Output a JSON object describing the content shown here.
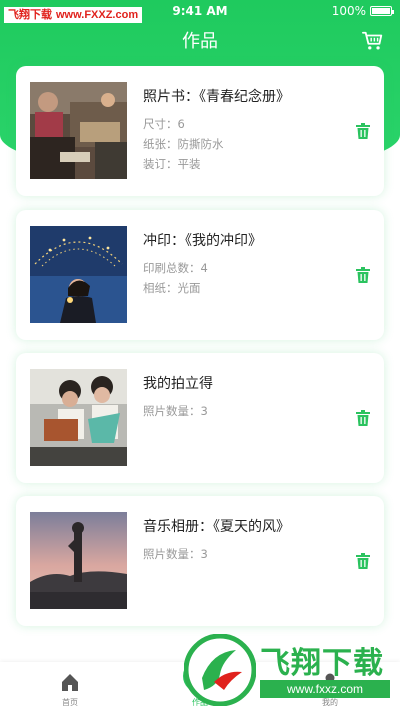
{
  "status_bar": {
    "watermark_label": "飞翔下载",
    "watermark_url": "www.FXXZ.com",
    "time": "9:41 AM",
    "battery": "100%"
  },
  "header": {
    "title": "作品",
    "cart_icon": "cart-icon"
  },
  "works": [
    {
      "title": "照片书：《青春纪念册》",
      "meta": [
        {
          "label": "尺寸：",
          "value": "6"
        },
        {
          "label": "纸张：",
          "value": "防撕防水"
        },
        {
          "label": "装订：",
          "value": "平装"
        }
      ],
      "photo": "street-market-photo"
    },
    {
      "title": "冲印：《我的冲印》",
      "meta": [
        {
          "label": "印刷总数：",
          "value": "4"
        },
        {
          "label": "相纸：",
          "value": "光面"
        }
      ],
      "photo": "girl-umbrella-lights-photo"
    },
    {
      "title": "我的拍立得",
      "meta": [
        {
          "label": "照片数量：",
          "value": "3"
        }
      ],
      "photo": "children-basket-photo"
    },
    {
      "title": "音乐相册：《夏天的风》",
      "meta": [
        {
          "label": "照片数量：",
          "value": "3"
        }
      ],
      "photo": "sunset-silhouette-photo"
    }
  ],
  "tabbar": {
    "tabs": [
      {
        "label": "首页",
        "icon": "home-icon"
      },
      {
        "label": "作品",
        "icon": "works-icon"
      },
      {
        "label": "我的",
        "icon": "profile-icon"
      }
    ],
    "active_tab": "作品"
  },
  "watermark_logo": {
    "text": "飞翔下载",
    "url": "www.fxxz.com"
  },
  "colors": {
    "brand_green": "#2bc35f",
    "header_green": "#1fca5e",
    "trash_green": "#2bc35f"
  }
}
